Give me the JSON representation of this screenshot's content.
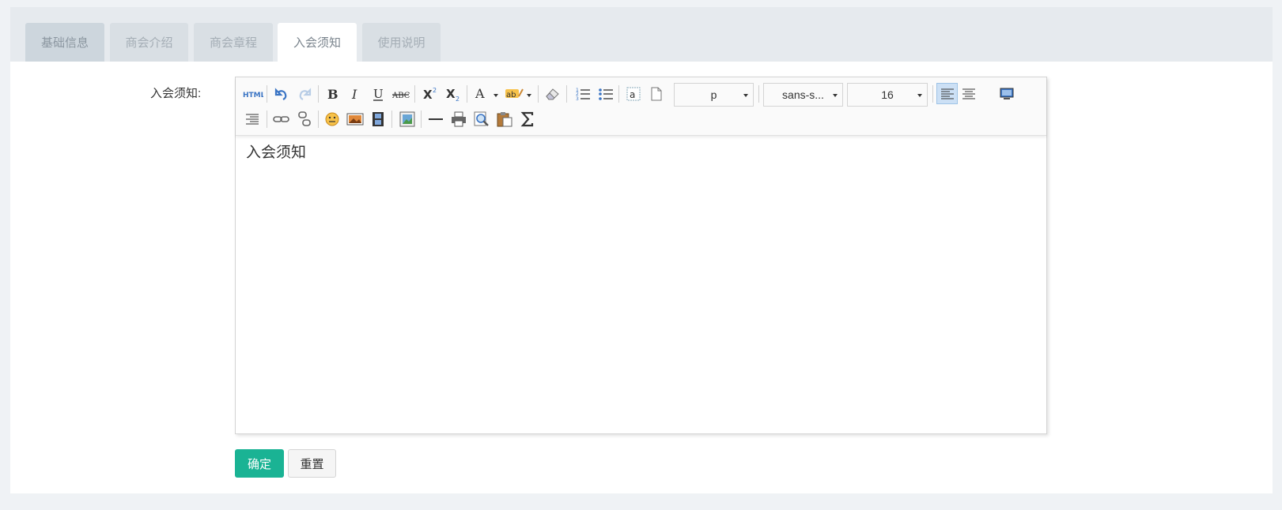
{
  "tabs": [
    {
      "label": "基础信息"
    },
    {
      "label": "商会介绍"
    },
    {
      "label": "商会章程"
    },
    {
      "label": "入会须知"
    },
    {
      "label": "使用说明"
    }
  ],
  "field": {
    "label": "入会须知:"
  },
  "editor": {
    "content": "入会须知",
    "toolbar": {
      "html_label": "HTML",
      "format_value": "p",
      "font_value": "sans-s...",
      "size_value": "16"
    }
  },
  "buttons": {
    "confirm": "确定",
    "reset": "重置"
  },
  "colors": {
    "primary": "#1ab394",
    "tabbar": "#e6eaee",
    "page_bg": "#eff2f5"
  }
}
